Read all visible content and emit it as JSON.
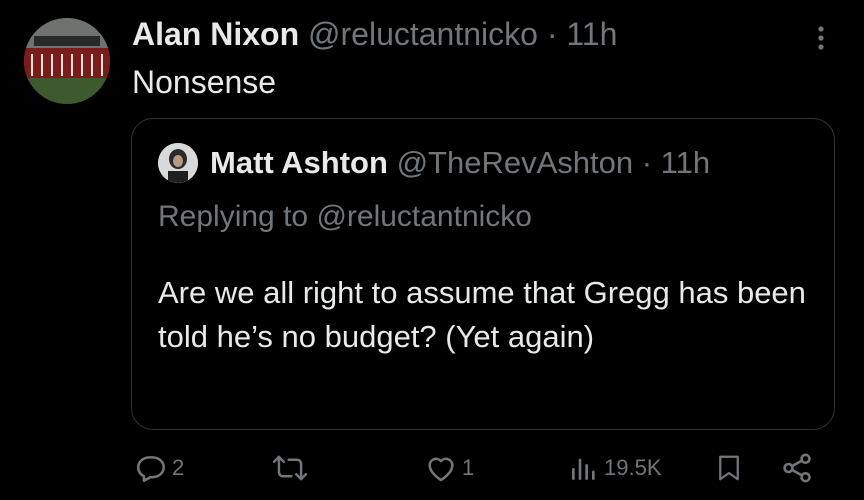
{
  "tweet": {
    "author_name": "Alan Nixon",
    "handle": "@reluctantnicko",
    "separator": "·",
    "time": "11h",
    "text": "Nonsense"
  },
  "quoted": {
    "author_name": "Matt Ashton",
    "handle": "@TheRevAshton",
    "separator": "·",
    "time": "11h",
    "replying_label": "Replying to",
    "replying_handle": "@reluctantnicko",
    "text": "Are we all right to assume that Gregg has been told he’s no budget? (Yet again)"
  },
  "actions": {
    "replies": "2",
    "likes": "1",
    "views": "19.5K"
  },
  "icons": [
    "more-icon",
    "reply-icon",
    "retweet-icon",
    "like-icon",
    "views-icon",
    "bookmark-icon",
    "share-icon"
  ],
  "colors": {
    "background": "#000000",
    "text": "#e7e9ea",
    "muted": "#71767b",
    "border": "#2f3336"
  }
}
